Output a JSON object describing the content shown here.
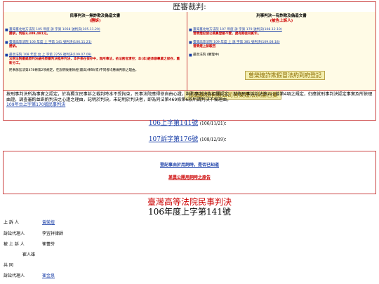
{
  "header": {
    "title": "歷審裁判:"
  },
  "left": {
    "title": "民事判決—無詐欺及偽造文書",
    "subtitle": "(勝訴)",
    "items": [
      {
        "link": "臺灣臺北地方法院 105 年度 訴 字第 1058 號判決(105.11.29)",
        "note": "勝訴，判賠3,309,481元。"
      },
      {
        "link": "臺灣高等法院 106 年度 上 字第 141 號判決(106.11.21)",
        "note": "勝訴。"
      },
      {
        "link": "最高法院 108 年度 台 上 字第 2256 號判決(109.07.09)",
        "note": "法院法院撤銷原判決維持原審判決程序判決，本件係在保存中，無所事法，依法務官清空；本(本)經承辦專業之保存，重新分工。"
      }
    ],
    "footer": "民事訴訟法第478條第2項規定，在說明後刪除經(最高)律師(或)不同者均應做判斷之理由。"
  },
  "right": {
    "title": "刑事判決—有詐欺及偽造文書",
    "subtitle": "(被告上訴人)",
    "items": [
      {
        "link": "臺灣臺北地方法院 107 年度 訴 字第 179 號判決(108.12.19)",
        "note": "曾榮煌犯使公務員登載不實，處有期徒刑貳年。"
      },
      {
        "link": "臺灣高等法院 109 年度 上 訴 字第 381 號判決(109.08.18)",
        "note": "曾榮煌上訴駁回"
      },
      {
        "link": "",
        "note": "最高法院 (審理中)"
      }
    ],
    "banner1": "曾榮煌詐欺假冒法約到府登記",
    "banner2": "炫頤顧問有限公司曾榮煌法決論合集"
  },
  "note": {
    "text": "按刑事判決所為事實之認定，於為獨立民事訴之裁判時本不受拘束，民事法院應得依自由心證，斟酌事判決為相關認定，然依民事訴訟法第222條第4項之規定，仍應就刑事判決認定事實及所依理由證，調查審酌並斟酌判決之心證之理由，記明於判決，未記明於判決者，即為同法第469條第6款所謂判決不備理由。",
    "link": "109年台上字第170號民事判決"
  },
  "rows": [
    {
      "link": "106上字第141號",
      "date": "(106/11/21)："
    },
    {
      "link": "107訴字第176號",
      "date": "(108/12/19)："
    }
  ],
  "mid": {
    "line1": "登記事由於用詞時，是否已知道",
    "line2": "差異公開用詞時之原告"
  },
  "court": "臺灣高等法院民事判決",
  "case": "106年度上字第141號",
  "parties": [
    {
      "role": "上 訴 人",
      "value": "曾榮煌"
    },
    {
      "role": "訴訟代理人",
      "value": "李宜祥律師"
    },
    {
      "role": "被 上 訴 人",
      "value": "崔蕾芬"
    },
    {
      "role": "崔人雄",
      "value": ""
    },
    {
      "role": "共 同",
      "value": ""
    },
    {
      "role": "訴訟代理人",
      "value": "崔金泉"
    }
  ]
}
